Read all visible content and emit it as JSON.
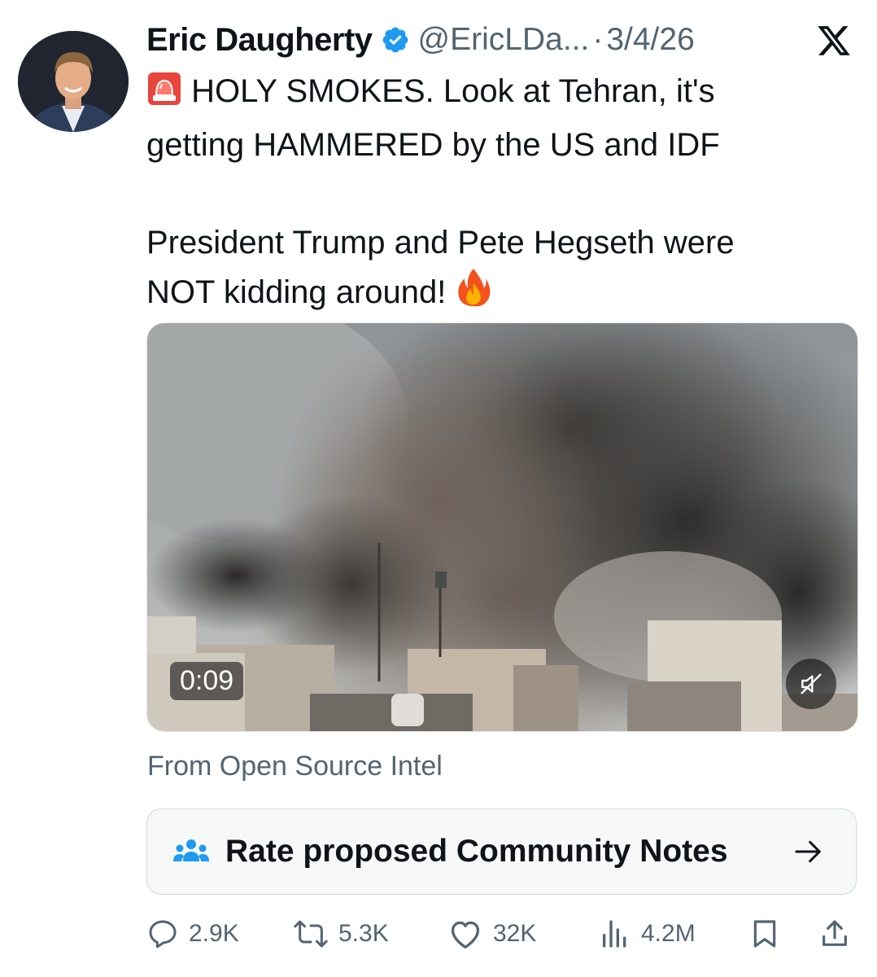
{
  "author": {
    "name": "Eric Daugherty",
    "handle": "@EricLDa...",
    "separator": "·",
    "date": "3/4/26",
    "verified": true,
    "avatar_icon": "avatar-photo"
  },
  "platform_icon": "x-logo-icon",
  "tweet": {
    "lines": [
      "HOLY SMOKES. Look at Tehran, it's",
      "getting HAMMERED by the US and IDF",
      "",
      "President Trump and Pete Hegseth were",
      "NOT kidding around!"
    ],
    "leading_emoji": "siren-emoji",
    "trailing_emoji": "fire-emoji"
  },
  "media": {
    "type": "video",
    "duration": "0:09",
    "muted": true,
    "description_icon": "video-thumbnail"
  },
  "source_label": "From Open Source Intel",
  "community_notes": {
    "label": "Rate proposed Community Notes",
    "icon": "people-icon",
    "arrow_icon": "arrow-right-icon"
  },
  "actions": {
    "replies": "2.9K",
    "reposts": "5.3K",
    "likes": "32K",
    "views": "4.2M"
  },
  "colors": {
    "text": "#0f1419",
    "secondary": "#536471",
    "verified": "#1d9bf0",
    "border": "#cfd9de"
  }
}
